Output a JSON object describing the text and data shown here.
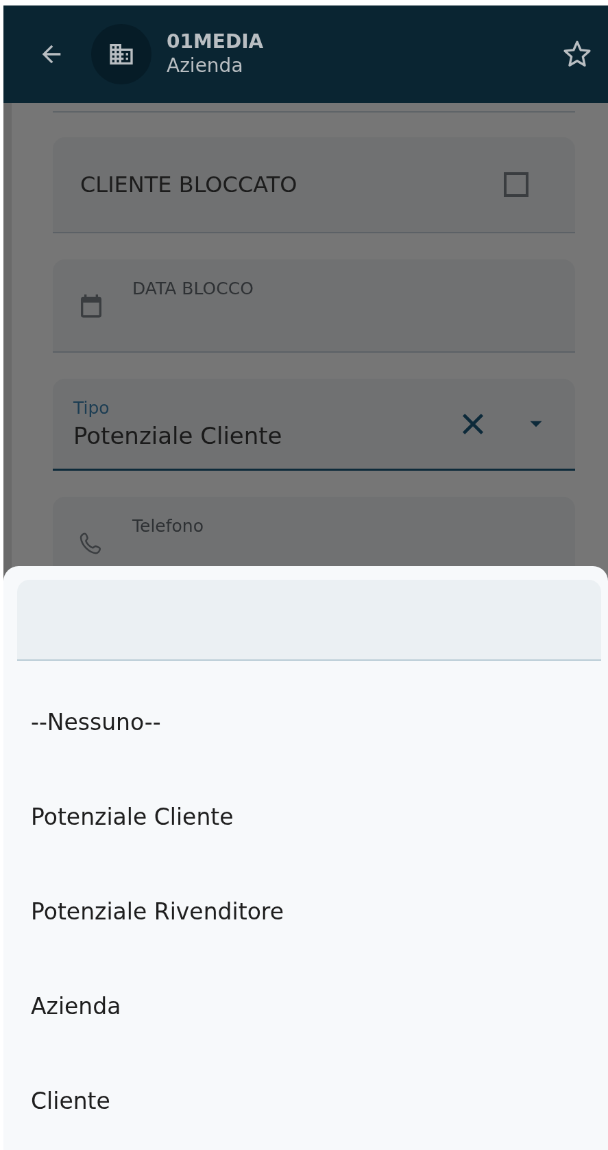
{
  "header": {
    "title": "01MEDIA",
    "subtitle": "Azienda"
  },
  "form": {
    "checkbox_field": {
      "label": "CLIENTE BLOCCATO",
      "checked": false
    },
    "date_field": {
      "label": "DATA BLOCCO"
    },
    "select_field": {
      "label": "Tipo",
      "value": "Potenziale Cliente"
    },
    "phone_field": {
      "label": "Telefono"
    }
  },
  "picker_sheet": {
    "options": [
      {
        "label": "--Nessuno--",
        "selected": false
      },
      {
        "label": "Potenziale Cliente",
        "selected": false
      },
      {
        "label": "Potenziale Rivenditore",
        "selected": false
      },
      {
        "label": "Azienda",
        "selected": false
      },
      {
        "label": "Cliente",
        "selected": false
      }
    ]
  }
}
